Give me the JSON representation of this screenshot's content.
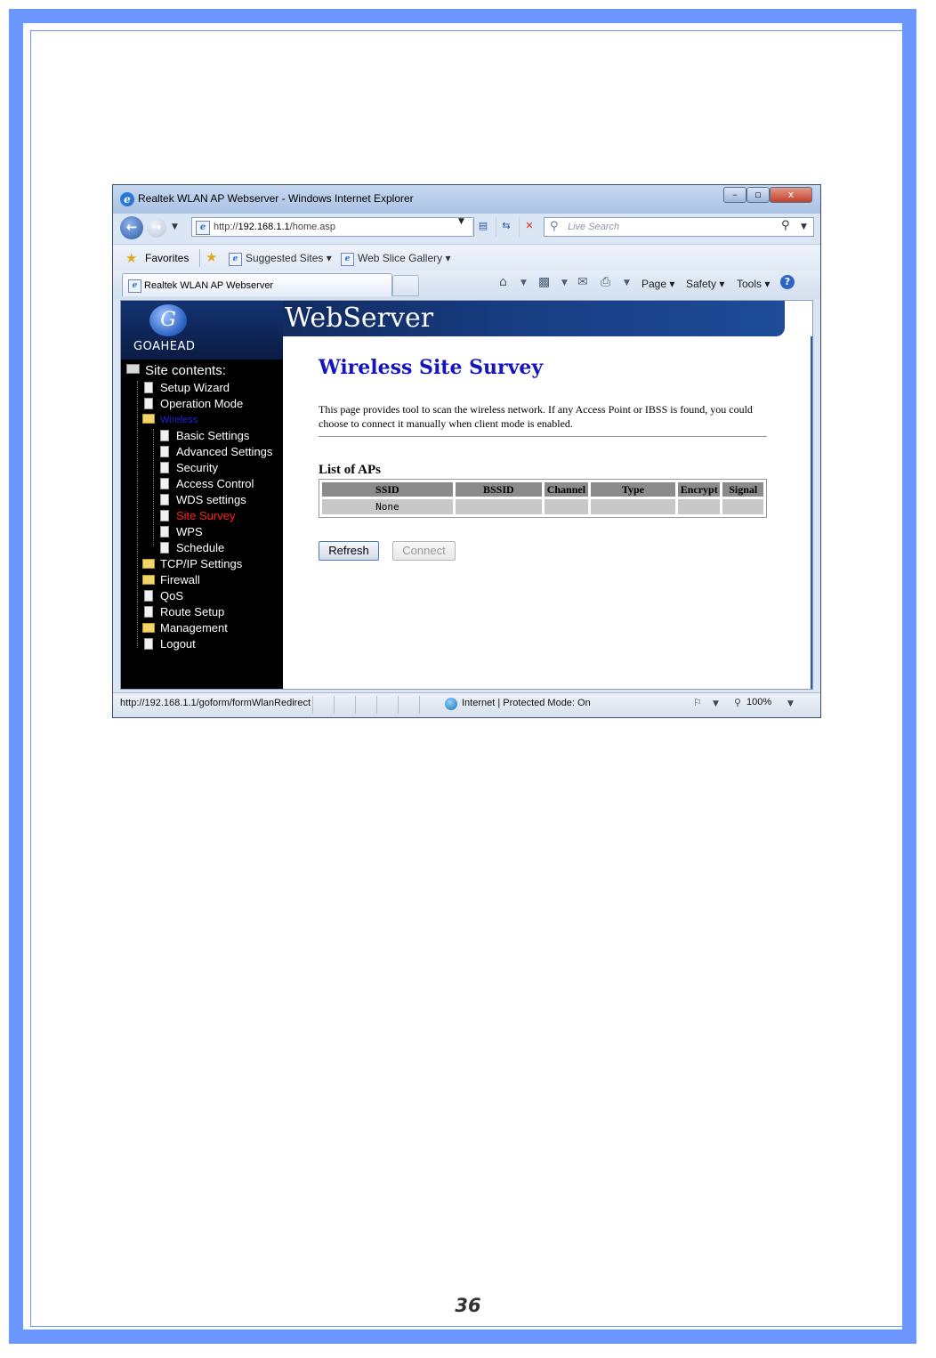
{
  "window": {
    "title": "Realtek WLAN AP Webserver - Windows Internet Explorer",
    "min_label": "–",
    "max_label": "▫",
    "close_label": "x"
  },
  "address_bar": {
    "url_prefix": "http://",
    "url_host": "192.168.1.1",
    "url_path": "/home.asp"
  },
  "search": {
    "placeholder": "Live Search"
  },
  "favorites_bar": {
    "favorites_label": "Favorites",
    "suggested_sites": "Suggested Sites ▾",
    "web_slice_gallery": "Web Slice Gallery ▾"
  },
  "tab": {
    "label": "Realtek WLAN AP Webserver"
  },
  "command_bar": {
    "page": "Page ▾",
    "safety": "Safety ▾",
    "tools": "Tools ▾",
    "help": "?"
  },
  "banner": {
    "logo_text": "GOAHEAD",
    "title": "WebServer"
  },
  "sidebar": {
    "heading": "Site contents:",
    "items": [
      {
        "label": "Setup Wizard"
      },
      {
        "label": "Operation Mode"
      },
      {
        "label": "Wireless"
      },
      {
        "label": "Basic Settings"
      },
      {
        "label": "Advanced Settings"
      },
      {
        "label": "Security"
      },
      {
        "label": "Access Control"
      },
      {
        "label": "WDS settings"
      },
      {
        "label": "Site Survey"
      },
      {
        "label": "WPS"
      },
      {
        "label": "Schedule"
      },
      {
        "label": "TCP/IP Settings"
      },
      {
        "label": "Firewall"
      },
      {
        "label": "QoS"
      },
      {
        "label": "Route Setup"
      },
      {
        "label": "Management"
      },
      {
        "label": "Logout"
      }
    ]
  },
  "main": {
    "heading": "Wireless Site Survey",
    "description": "This page provides tool to scan the wireless network. If any Access Point or IBSS is found, you could choose to connect it manually when client mode is enabled.",
    "list_title": "List of APs",
    "table": {
      "headers": [
        "SSID",
        "BSSID",
        "Channel",
        "Type",
        "Encrypt",
        "Signal"
      ],
      "rows": [
        [
          "None",
          "",
          "",
          "",
          "",
          ""
        ]
      ]
    },
    "refresh_button": "Refresh",
    "connect_button": "Connect"
  },
  "status_bar": {
    "url": "http://192.168.1.1/goform/formWlanRedirect",
    "zone": "Internet | Protected Mode: On",
    "zoom": "100%"
  },
  "page_number": "36",
  "colors": {
    "frame": "#6b95ff",
    "heading": "#1515c0",
    "nav_active": "#ff2020",
    "nav_wireless": "#2222dd"
  }
}
